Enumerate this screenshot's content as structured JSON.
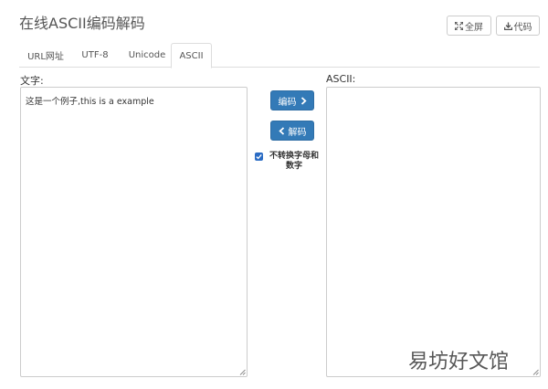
{
  "header": {
    "title": "在线ASCII编码解码",
    "fullscreen_label": "全屏",
    "code_label": "代码"
  },
  "tabs": [
    {
      "label": "URL网址",
      "active": false
    },
    {
      "label": "UTF-8",
      "active": false
    },
    {
      "label": "Unicode",
      "active": false
    },
    {
      "label": "ASCII",
      "active": true
    }
  ],
  "input": {
    "label": "文字:",
    "value": "这是一个例子,this is a example"
  },
  "output": {
    "label": "ASCII:",
    "value": ""
  },
  "actions": {
    "encode_label": "编码",
    "decode_label": "解码"
  },
  "option": {
    "label": "不转换字母和数字",
    "checked": true
  },
  "watermark": {
    "text": "易坊好文馆"
  },
  "colors": {
    "primary_button": "#337ab7",
    "border": "#cccccc",
    "checkbox": "#2b6cc4"
  }
}
